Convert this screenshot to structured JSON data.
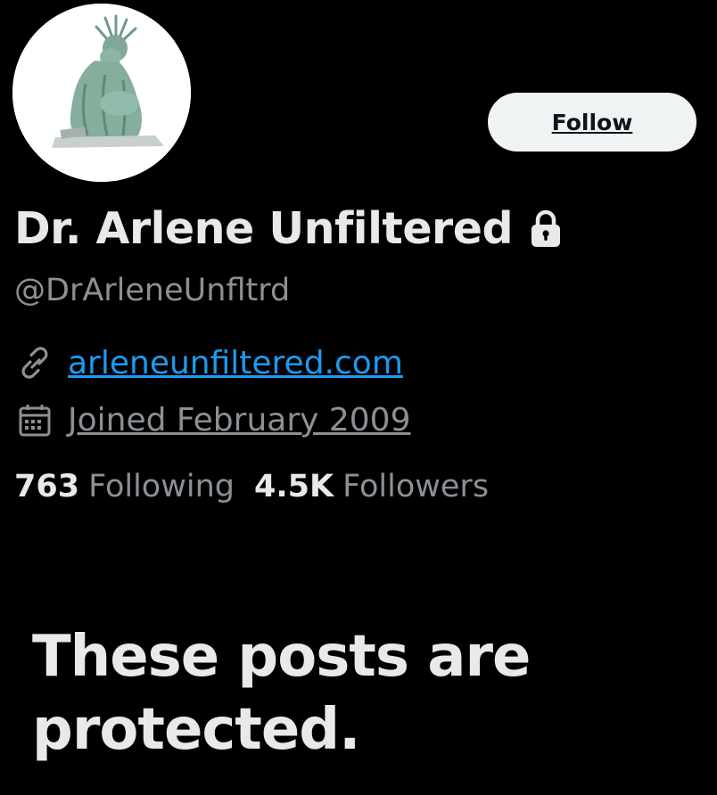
{
  "profile": {
    "display_name": "Dr. Arlene Unfiltered",
    "handle": "@DrArleneUnfltrd",
    "website": "arleneunfiltered.com",
    "joined": "Joined February 2009",
    "protected": true
  },
  "actions": {
    "follow_label": "Follow"
  },
  "stats": {
    "following_count": "763",
    "following_label": "Following",
    "followers_count": "4.5K",
    "followers_label": "Followers"
  },
  "notice": {
    "protected_message": "These posts are protected."
  },
  "icons": {
    "lock": "lock-icon",
    "link": "link-icon",
    "calendar": "calendar-icon"
  },
  "colors": {
    "background": "#000000",
    "text_primary": "#e7e9ea",
    "text_secondary": "#8b9095",
    "link": "#1d9bf0",
    "button_bg": "#eff3f4"
  }
}
